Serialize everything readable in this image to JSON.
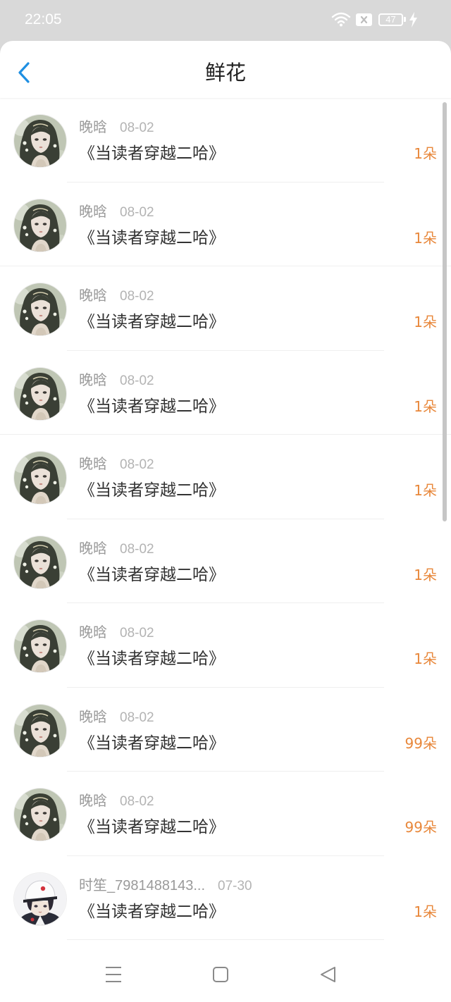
{
  "status_bar": {
    "time": "22:05",
    "battery_level": "47",
    "icons": [
      "wifi-icon",
      "no-sim-icon",
      "battery-icon",
      "charging-icon"
    ]
  },
  "header": {
    "title": "鲜花",
    "back_icon": "chevron-left-icon"
  },
  "colors": {
    "accent": "#1e8fe2",
    "count": "#e8873a",
    "status_bar_bg": "#d9d9d9"
  },
  "list": {
    "items": [
      {
        "user": "晚晗",
        "date": "08-02",
        "book": "《当读者穿越二哈》",
        "count": "1朵",
        "avatar": "girl-avatar"
      },
      {
        "user": "晚晗",
        "date": "08-02",
        "book": "《当读者穿越二哈》",
        "count": "1朵",
        "avatar": "girl-avatar"
      },
      {
        "user": "晚晗",
        "date": "08-02",
        "book": "《当读者穿越二哈》",
        "count": "1朵",
        "avatar": "girl-avatar"
      },
      {
        "user": "晚晗",
        "date": "08-02",
        "book": "《当读者穿越二哈》",
        "count": "1朵",
        "avatar": "girl-avatar"
      },
      {
        "user": "晚晗",
        "date": "08-02",
        "book": "《当读者穿越二哈》",
        "count": "1朵",
        "avatar": "girl-avatar"
      },
      {
        "user": "晚晗",
        "date": "08-02",
        "book": "《当读者穿越二哈》",
        "count": "1朵",
        "avatar": "girl-avatar"
      },
      {
        "user": "晚晗",
        "date": "08-02",
        "book": "《当读者穿越二哈》",
        "count": "1朵",
        "avatar": "girl-avatar"
      },
      {
        "user": "晚晗",
        "date": "08-02",
        "book": "《当读者穿越二哈》",
        "count": "99朵",
        "avatar": "girl-avatar"
      },
      {
        "user": "晚晗",
        "date": "08-02",
        "book": "《当读者穿越二哈》",
        "count": "99朵",
        "avatar": "girl-avatar"
      },
      {
        "user": "时笙_7981488143...",
        "date": "07-30",
        "book": "《当读者穿越二哈》",
        "count": "1朵",
        "avatar": "boy-avatar"
      }
    ]
  },
  "nav_bar": {
    "icons": [
      "menu-icon",
      "home-icon",
      "back-icon"
    ]
  }
}
